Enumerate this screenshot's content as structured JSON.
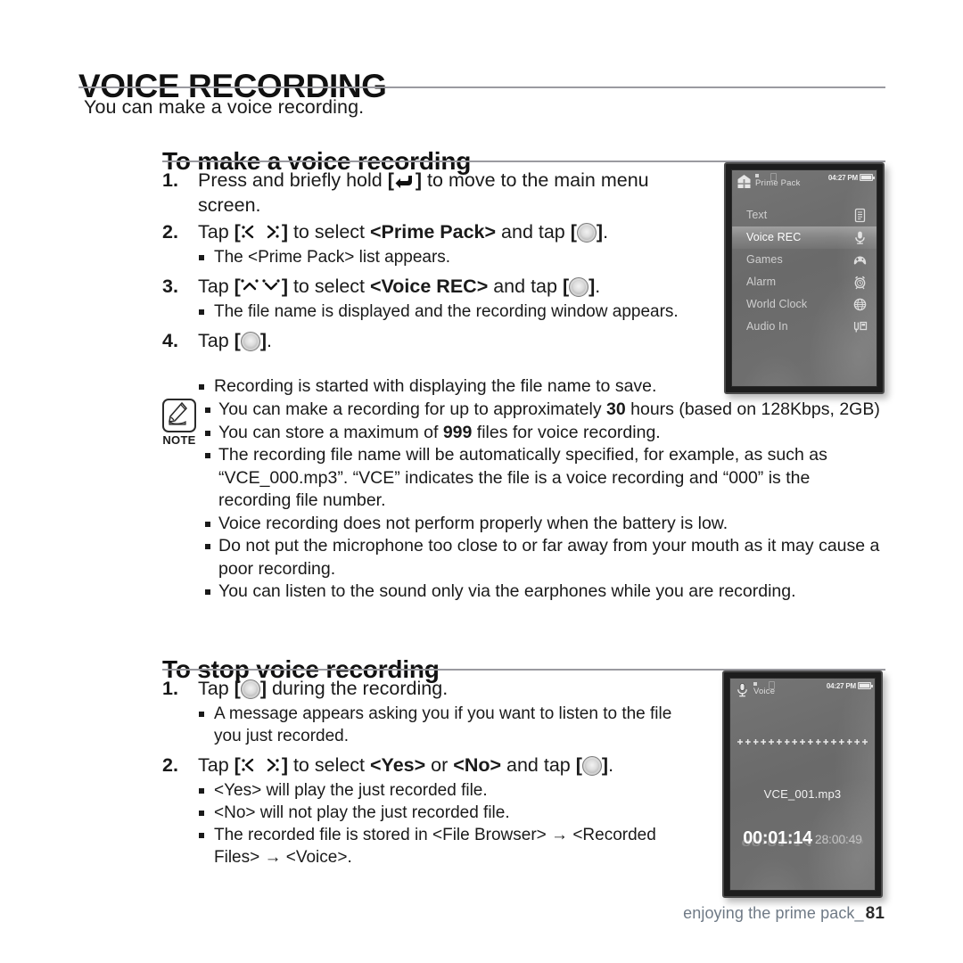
{
  "document": {
    "title": "VOICE RECORDING",
    "intro": "You can make a voice recording.",
    "footer_text": "enjoying the prime pack_",
    "page_number": "81"
  },
  "section_make": {
    "heading": "To make a voice recording",
    "steps": [
      {
        "number": "1.",
        "parts": [
          {
            "t": "text",
            "v": "Press and briefly hold "
          },
          {
            "t": "bracket-return"
          },
          {
            "t": "text",
            "v": " to move to the main menu screen."
          }
        ],
        "bullets": []
      },
      {
        "number": "2.",
        "parts": [
          {
            "t": "text",
            "v": "Tap "
          },
          {
            "t": "bracket-leftright"
          },
          {
            "t": "text",
            "v": " to select "
          },
          {
            "t": "bold",
            "v": "<Prime Pack>"
          },
          {
            "t": "text",
            "v": " and tap "
          },
          {
            "t": "bracket-select"
          },
          {
            "t": "text",
            "v": "."
          }
        ],
        "bullets": [
          "The <Prime Pack> list appears."
        ]
      },
      {
        "number": "3.",
        "parts": [
          {
            "t": "text",
            "v": "Tap "
          },
          {
            "t": "bracket-updown"
          },
          {
            "t": "text",
            "v": " to select "
          },
          {
            "t": "bold",
            "v": "<Voice REC>"
          },
          {
            "t": "text",
            "v": " and tap "
          },
          {
            "t": "bracket-select"
          },
          {
            "t": "text",
            "v": "."
          }
        ],
        "bullets": [
          "The file name is displayed and the recording window appears."
        ]
      },
      {
        "number": "4.",
        "parts": [
          {
            "t": "text",
            "v": "Tap "
          },
          {
            "t": "bracket-select"
          },
          {
            "t": "text",
            "v": "."
          }
        ],
        "bullets": []
      }
    ],
    "loose_bullet": "Recording is started with displaying the file name to save."
  },
  "note": {
    "label": "NOTE",
    "bullets": [
      {
        "pre": "You can make a recording for up to approximately ",
        "strong": "30",
        "post": " hours (based on 128Kbps, 2GB)"
      },
      {
        "pre": "You can store a maximum of ",
        "strong": "999",
        "post": " files for voice recording."
      },
      {
        "pre": "The recording file name will be automatically specified, for example, as such as “VCE_000.mp3”. “VCE” indicates the file is a voice recording and “000” is the recording file number.",
        "strong": "",
        "post": ""
      },
      {
        "pre": "Voice recording does not perform properly when the battery is low.",
        "strong": "",
        "post": ""
      },
      {
        "pre": "Do not put the microphone too close to or far away from your mouth as it may cause a poor recording.",
        "strong": "",
        "post": ""
      },
      {
        "pre": "You can listen to the sound only via the earphones while you are recording.",
        "strong": "",
        "post": ""
      }
    ]
  },
  "section_stop": {
    "heading": "To stop voice recording",
    "steps": [
      {
        "number": "1.",
        "parts": [
          {
            "t": "text",
            "v": "Tap "
          },
          {
            "t": "bracket-select"
          },
          {
            "t": "text",
            "v": " during the recording."
          }
        ],
        "bullets": [
          "A message appears asking you if you want to listen to the file you just recorded."
        ]
      },
      {
        "number": "2.",
        "parts": [
          {
            "t": "text",
            "v": "Tap "
          },
          {
            "t": "bracket-leftright"
          },
          {
            "t": "text",
            "v": " to select "
          },
          {
            "t": "bold",
            "v": "<Yes>"
          },
          {
            "t": "text",
            "v": " or "
          },
          {
            "t": "bold",
            "v": "<No>"
          },
          {
            "t": "text",
            "v": " and tap "
          },
          {
            "t": "bracket-select"
          },
          {
            "t": "text",
            "v": "."
          }
        ],
        "bullets": [
          "<Yes> will play the just recorded file.",
          "<No> will not play the just recorded file.",
          "The recorded file is stored in <File Browser> → <Recorded Files> → <Voice>."
        ]
      }
    ]
  },
  "device_menu": {
    "status": {
      "title": "Prime Pack",
      "time": "04:27 PM",
      "app_icon": "prime-pack-icon",
      "battery_icon": "battery-icon"
    },
    "items": [
      {
        "label": "Text",
        "icon": "document-icon",
        "selected": false
      },
      {
        "label": "Voice REC",
        "icon": "microphone-icon",
        "selected": true
      },
      {
        "label": "Games",
        "icon": "gamepad-icon",
        "selected": false
      },
      {
        "label": "Alarm",
        "icon": "alarm-clock-icon",
        "selected": false
      },
      {
        "label": "World Clock",
        "icon": "globe-icon",
        "selected": false
      },
      {
        "label": "Audio In",
        "icon": "audio-in-icon",
        "selected": false
      }
    ]
  },
  "device_recording": {
    "status": {
      "title": "Voice",
      "time": "04:27 PM",
      "app_icon": "microphone-icon",
      "battery_icon": "battery-icon"
    },
    "marker_count": 17,
    "file_name": "VCE_001.mp3",
    "elapsed_time": "00:01:14",
    "total_time": "28:00:49"
  },
  "colors": {
    "rule": "#9a9aa0",
    "text": "#1a1a1a",
    "footer": "#6f7a86",
    "screen_bg": "#6d6d6d",
    "device_frame": "#1d1d1d"
  }
}
